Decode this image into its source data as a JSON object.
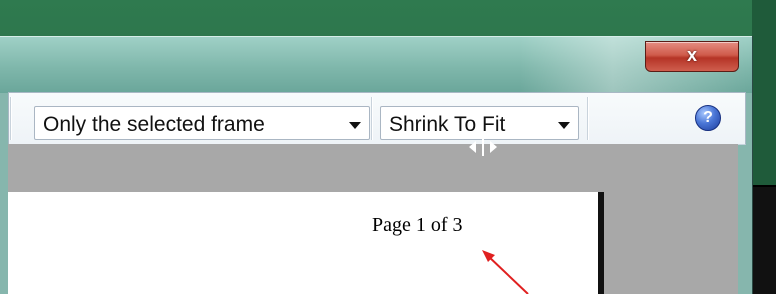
{
  "window": {
    "close_label": "x"
  },
  "toolbar": {
    "print_what_value": "Only the selected frame",
    "scale_value": "Shrink To Fit",
    "help_label": "?"
  },
  "preview": {
    "page_label": "Page 1 of 3"
  },
  "colors": {
    "desktop": "#2a6f47",
    "titlebar": "#86b6ad",
    "close_button": "#c94636",
    "preview_background": "#a8a8a8",
    "annotation_arrow": "#e02020"
  },
  "icons": [
    "close-icon",
    "dropdown-arrow-icon",
    "help-icon",
    "column-resize-icon",
    "annotation-arrow-icon"
  ]
}
